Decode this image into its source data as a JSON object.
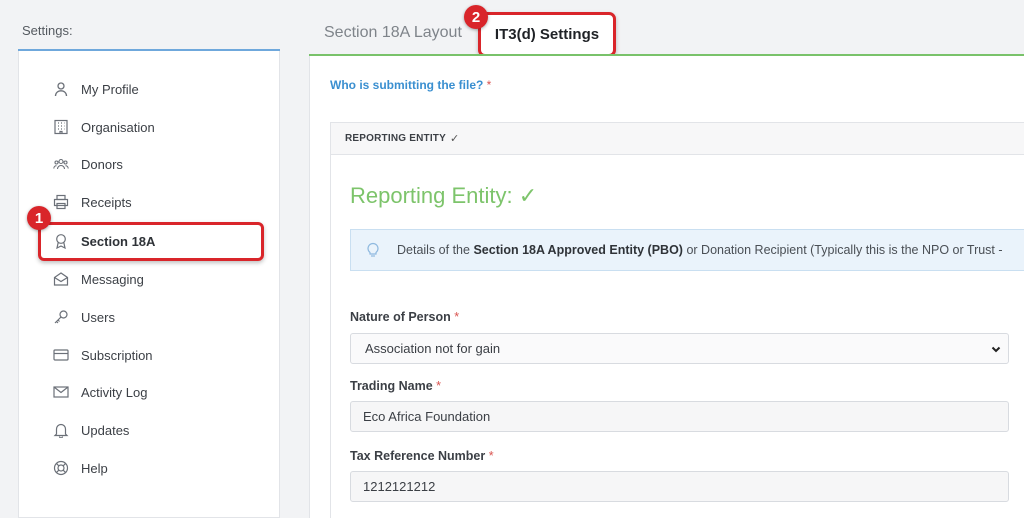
{
  "sidebar": {
    "heading": "Settings:",
    "items": [
      {
        "label": "My Profile",
        "icon": "user-icon"
      },
      {
        "label": "Organisation",
        "icon": "building-icon"
      },
      {
        "label": "Donors",
        "icon": "people-icon"
      },
      {
        "label": "Receipts",
        "icon": "printer-icon"
      },
      {
        "label": "Section 18A",
        "icon": "award-icon",
        "active": true
      },
      {
        "label": "Messaging",
        "icon": "envelope-open-icon"
      },
      {
        "label": "Users",
        "icon": "key-icon"
      },
      {
        "label": "Subscription",
        "icon": "credit-card-icon"
      },
      {
        "label": "Activity Log",
        "icon": "mail-icon"
      },
      {
        "label": "Updates",
        "icon": "bell-icon"
      },
      {
        "label": "Help",
        "icon": "lifebuoy-icon"
      }
    ]
  },
  "annotations": {
    "badge1": "1",
    "badge2": "2"
  },
  "tabs": [
    {
      "label": "Section 18A Layout"
    },
    {
      "label": "IT3(d) Settings",
      "active": true
    }
  ],
  "main": {
    "question": "Who is submitting the file?",
    "required_mark": "*",
    "card_header": "REPORTING ENTITY",
    "card_header_check": "✓",
    "entity_title": "Reporting Entity: ✓",
    "info": {
      "prefix": "Details of the ",
      "bold": "Section 18A Approved Entity (PBO)",
      "suffix": " or Donation Recipient (Typically this is the NPO or Trust -"
    },
    "fields": {
      "nature_label": "Nature of Person",
      "nature_value": "Association not for gain",
      "trading_label": "Trading Name",
      "trading_value": "Eco Africa Foundation",
      "tax_label": "Tax Reference Number",
      "tax_value": "1212121212"
    }
  },
  "colors": {
    "accent_blue": "#3a8fd0",
    "accent_green": "#7dc46b",
    "annotation_red": "#d9252a"
  }
}
